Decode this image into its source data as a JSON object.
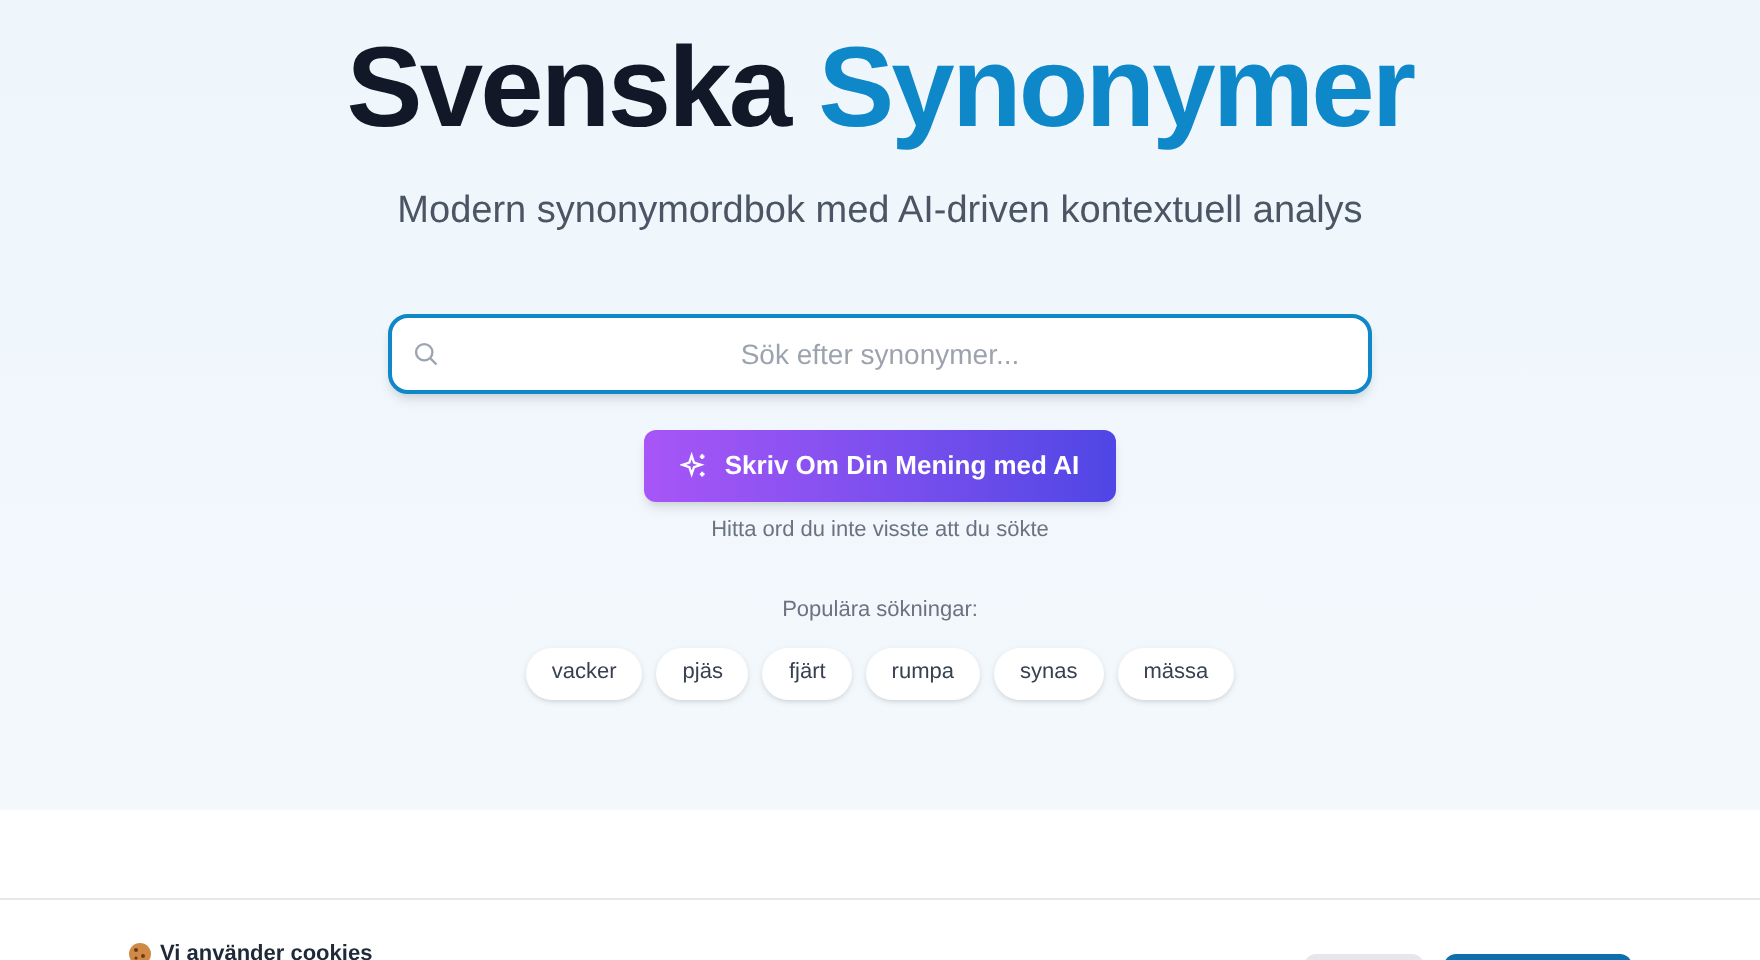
{
  "hero": {
    "title_dark": "Svenska",
    "title_accent": "Synonymer",
    "subtitle": "Modern synonymordbok med AI-driven kontextuell analys"
  },
  "search": {
    "placeholder": "Sök efter synonymer..."
  },
  "ai_button": {
    "label": "Skriv Om Din Mening med AI"
  },
  "ai_hint": "Hitta ord du inte visste att du sökte",
  "popular": {
    "label": "Populära sökningar:",
    "tags": [
      "vacker",
      "pjäs",
      "fjärt",
      "rumpa",
      "synas",
      "mässa"
    ]
  },
  "cookie_banner": {
    "title": "Vi använder cookies"
  }
}
